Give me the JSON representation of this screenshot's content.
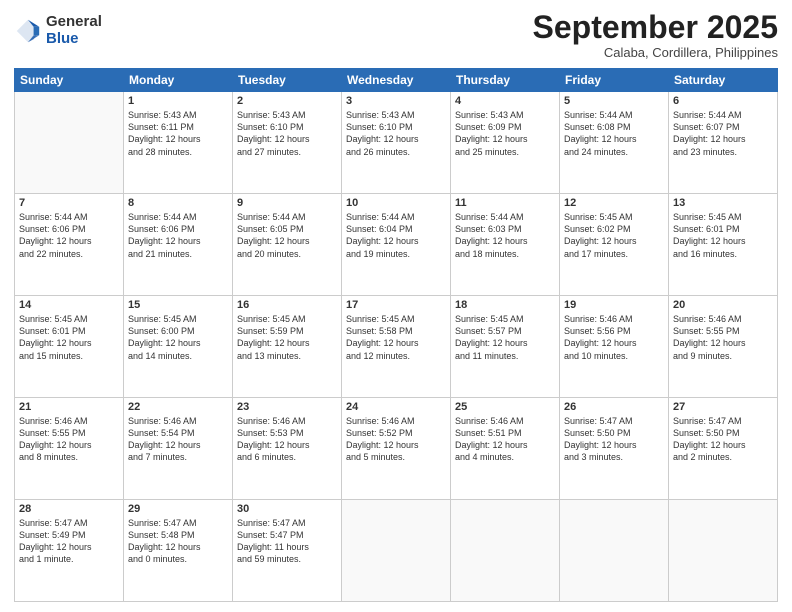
{
  "logo": {
    "general": "General",
    "blue": "Blue"
  },
  "title": "September 2025",
  "subtitle": "Calaba, Cordillera, Philippines",
  "headers": [
    "Sunday",
    "Monday",
    "Tuesday",
    "Wednesday",
    "Thursday",
    "Friday",
    "Saturday"
  ],
  "weeks": [
    [
      {
        "day": "",
        "text": ""
      },
      {
        "day": "1",
        "text": "Sunrise: 5:43 AM\nSunset: 6:11 PM\nDaylight: 12 hours\nand 28 minutes."
      },
      {
        "day": "2",
        "text": "Sunrise: 5:43 AM\nSunset: 6:10 PM\nDaylight: 12 hours\nand 27 minutes."
      },
      {
        "day": "3",
        "text": "Sunrise: 5:43 AM\nSunset: 6:10 PM\nDaylight: 12 hours\nand 26 minutes."
      },
      {
        "day": "4",
        "text": "Sunrise: 5:43 AM\nSunset: 6:09 PM\nDaylight: 12 hours\nand 25 minutes."
      },
      {
        "day": "5",
        "text": "Sunrise: 5:44 AM\nSunset: 6:08 PM\nDaylight: 12 hours\nand 24 minutes."
      },
      {
        "day": "6",
        "text": "Sunrise: 5:44 AM\nSunset: 6:07 PM\nDaylight: 12 hours\nand 23 minutes."
      }
    ],
    [
      {
        "day": "7",
        "text": "Sunrise: 5:44 AM\nSunset: 6:06 PM\nDaylight: 12 hours\nand 22 minutes."
      },
      {
        "day": "8",
        "text": "Sunrise: 5:44 AM\nSunset: 6:06 PM\nDaylight: 12 hours\nand 21 minutes."
      },
      {
        "day": "9",
        "text": "Sunrise: 5:44 AM\nSunset: 6:05 PM\nDaylight: 12 hours\nand 20 minutes."
      },
      {
        "day": "10",
        "text": "Sunrise: 5:44 AM\nSunset: 6:04 PM\nDaylight: 12 hours\nand 19 minutes."
      },
      {
        "day": "11",
        "text": "Sunrise: 5:44 AM\nSunset: 6:03 PM\nDaylight: 12 hours\nand 18 minutes."
      },
      {
        "day": "12",
        "text": "Sunrise: 5:45 AM\nSunset: 6:02 PM\nDaylight: 12 hours\nand 17 minutes."
      },
      {
        "day": "13",
        "text": "Sunrise: 5:45 AM\nSunset: 6:01 PM\nDaylight: 12 hours\nand 16 minutes."
      }
    ],
    [
      {
        "day": "14",
        "text": "Sunrise: 5:45 AM\nSunset: 6:01 PM\nDaylight: 12 hours\nand 15 minutes."
      },
      {
        "day": "15",
        "text": "Sunrise: 5:45 AM\nSunset: 6:00 PM\nDaylight: 12 hours\nand 14 minutes."
      },
      {
        "day": "16",
        "text": "Sunrise: 5:45 AM\nSunset: 5:59 PM\nDaylight: 12 hours\nand 13 minutes."
      },
      {
        "day": "17",
        "text": "Sunrise: 5:45 AM\nSunset: 5:58 PM\nDaylight: 12 hours\nand 12 minutes."
      },
      {
        "day": "18",
        "text": "Sunrise: 5:45 AM\nSunset: 5:57 PM\nDaylight: 12 hours\nand 11 minutes."
      },
      {
        "day": "19",
        "text": "Sunrise: 5:46 AM\nSunset: 5:56 PM\nDaylight: 12 hours\nand 10 minutes."
      },
      {
        "day": "20",
        "text": "Sunrise: 5:46 AM\nSunset: 5:55 PM\nDaylight: 12 hours\nand 9 minutes."
      }
    ],
    [
      {
        "day": "21",
        "text": "Sunrise: 5:46 AM\nSunset: 5:55 PM\nDaylight: 12 hours\nand 8 minutes."
      },
      {
        "day": "22",
        "text": "Sunrise: 5:46 AM\nSunset: 5:54 PM\nDaylight: 12 hours\nand 7 minutes."
      },
      {
        "day": "23",
        "text": "Sunrise: 5:46 AM\nSunset: 5:53 PM\nDaylight: 12 hours\nand 6 minutes."
      },
      {
        "day": "24",
        "text": "Sunrise: 5:46 AM\nSunset: 5:52 PM\nDaylight: 12 hours\nand 5 minutes."
      },
      {
        "day": "25",
        "text": "Sunrise: 5:46 AM\nSunset: 5:51 PM\nDaylight: 12 hours\nand 4 minutes."
      },
      {
        "day": "26",
        "text": "Sunrise: 5:47 AM\nSunset: 5:50 PM\nDaylight: 12 hours\nand 3 minutes."
      },
      {
        "day": "27",
        "text": "Sunrise: 5:47 AM\nSunset: 5:50 PM\nDaylight: 12 hours\nand 2 minutes."
      }
    ],
    [
      {
        "day": "28",
        "text": "Sunrise: 5:47 AM\nSunset: 5:49 PM\nDaylight: 12 hours\nand 1 minute."
      },
      {
        "day": "29",
        "text": "Sunrise: 5:47 AM\nSunset: 5:48 PM\nDaylight: 12 hours\nand 0 minutes."
      },
      {
        "day": "30",
        "text": "Sunrise: 5:47 AM\nSunset: 5:47 PM\nDaylight: 11 hours\nand 59 minutes."
      },
      {
        "day": "",
        "text": ""
      },
      {
        "day": "",
        "text": ""
      },
      {
        "day": "",
        "text": ""
      },
      {
        "day": "",
        "text": ""
      }
    ]
  ]
}
